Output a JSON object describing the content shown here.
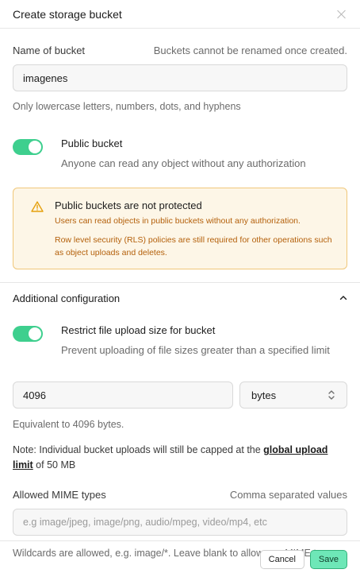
{
  "header": {
    "title": "Create storage bucket"
  },
  "name_field": {
    "label": "Name of bucket",
    "hint": "Buckets cannot be renamed once created.",
    "value": "imagenes",
    "help": "Only lowercase letters, numbers, dots, and hyphens"
  },
  "public_toggle": {
    "label": "Public bucket",
    "description": "Anyone can read any object without any authorization",
    "on": true
  },
  "warning": {
    "title": "Public buckets are not protected",
    "line1": "Users can read objects in public buckets without any authorization.",
    "line2": "Row level security (RLS) policies are still required for other operations such as object uploads and deletes."
  },
  "additional": {
    "title": "Additional configuration"
  },
  "restrict_toggle": {
    "label": "Restrict file upload size for bucket",
    "description": "Prevent uploading of file sizes greater than a specified limit",
    "on": true
  },
  "size": {
    "value": "4096",
    "unit": "bytes",
    "equivalent": "Equivalent to 4096 bytes."
  },
  "note": {
    "prefix": "Note: Individual bucket uploads will still be capped at the ",
    "link": "global upload limit",
    "suffix": " of 50 MB"
  },
  "mime": {
    "label": "Allowed MIME types",
    "hint": "Comma separated values",
    "placeholder": "e.g image/jpeg, image/png, audio/mpeg, video/mp4, etc",
    "help": "Wildcards are allowed, e.g. image/*. Leave blank to allow any MIME type."
  },
  "footer": {
    "cancel_label": "Cancel",
    "save_label": "Save"
  },
  "colors": {
    "accent": "#3ecf8e",
    "warning_border": "#f0c77a",
    "warning_bg": "#fdf6e7",
    "warning_text": "#b4600b",
    "save_bg": "#6ee7b7"
  }
}
